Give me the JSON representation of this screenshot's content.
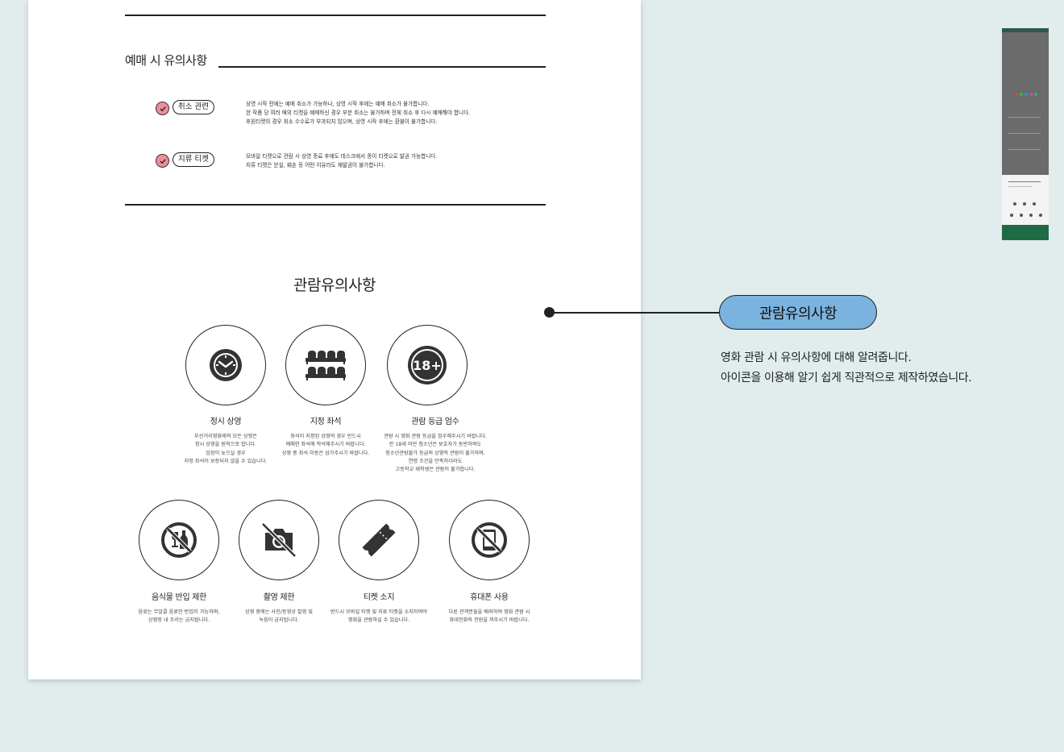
{
  "ticket_notes": {
    "title": "예매 시 유의사항",
    "items": [
      {
        "label": "취소 관련",
        "lines": [
          "상영 시작 전에는 예매 취소가 가능하나, 상영 시작 후에는 예매 취소가 불가합니다.",
          "한 작품 당 여러 매의 티켓을 예매하신 경우 부분 취소는 불가하며 전체 취소 후 다시 예매해야 합니다.",
          "후원티켓의 경우 취소 수수료가 부과되지 않으며, 상영 시작 후에는 환불이 불가합니다."
        ]
      },
      {
        "label": "지류 티켓",
        "lines": [
          "모바일 티켓으로 관람 시 상영 종료 후에도 데스크에서 종이 티켓으로 발권 가능합니다.",
          "지류 티켓은 분실, 훼손 등 어떤 이유라도 재발권이 불가합니다."
        ]
      }
    ]
  },
  "viewing_notes": {
    "title": "관람유의사항",
    "row1": [
      {
        "icon": "clock-icon",
        "title": "정시 상영",
        "lines": [
          "부산거리영화제의 모든 상영은",
          "정시 상영을 원칙으로 합니다.",
          "입장이 늦으실 경우",
          "지정 좌석이 보장되지 않을 수 있습니다."
        ]
      },
      {
        "icon": "seats-icon",
        "title": "지정 좌석",
        "lines": [
          "좌석이 지정된 상영의 경우 반드시",
          "예매한 좌석에 착석해주시기 바랍니다.",
          "상영 중 좌석 이동은 삼가주시기 바랍니다."
        ]
      },
      {
        "icon": "age-18-icon",
        "badge": "18+",
        "title": "관람 등급 엄수",
        "lines": [
          "관람 시 영화 관람 등급을 엄수해주시기 바랍니다.",
          "만 18세 미만 청소년은 보호자가 동반하여도",
          "청소년관람불가 등급의 상영작 관람이 불가하며,",
          "연령 조건을 만족하더라도",
          "고등학교 재학생은 관람이 불가합니다."
        ]
      }
    ],
    "row2": [
      {
        "icon": "no-food-icon",
        "title": "음식물 반입 제한",
        "lines": [
          "음료는 무알콜 음료만 반입이 가능하며,",
          "상영장 내 조리는 금지됩니다."
        ]
      },
      {
        "icon": "no-camera-icon",
        "title": "촬영 제한",
        "lines": [
          "상영 중에는 사진/동영상 촬영 및",
          "녹음이 금지됩니다."
        ]
      },
      {
        "icon": "ticket-icon",
        "title": "티켓 소지",
        "lines": [
          "반드시 모바일 티켓 및 지류 티켓을 소지하여야",
          "영화을 관람하실 수 있습니다."
        ]
      },
      {
        "icon": "no-phone-icon",
        "title": "휴대폰 사용",
        "lines": [
          "다른 관객분들을 배려하여 영화 관람 시",
          "휴대전화의 전원을 꺼주시기 바랍니다."
        ]
      }
    ]
  },
  "callout": {
    "label": "관람유의사항",
    "description": [
      "영화 관람 시 유의사항에 대해 알려줍니다.",
      "아이콘을 이용해 알기 쉽게 직관적으로 제작하였습니다."
    ]
  },
  "colors": {
    "background": "#e1ecec",
    "callout_fill": "#7bb3df",
    "check_fill": "#f08d9a",
    "thumbnail_footer": "#1f6b45"
  }
}
